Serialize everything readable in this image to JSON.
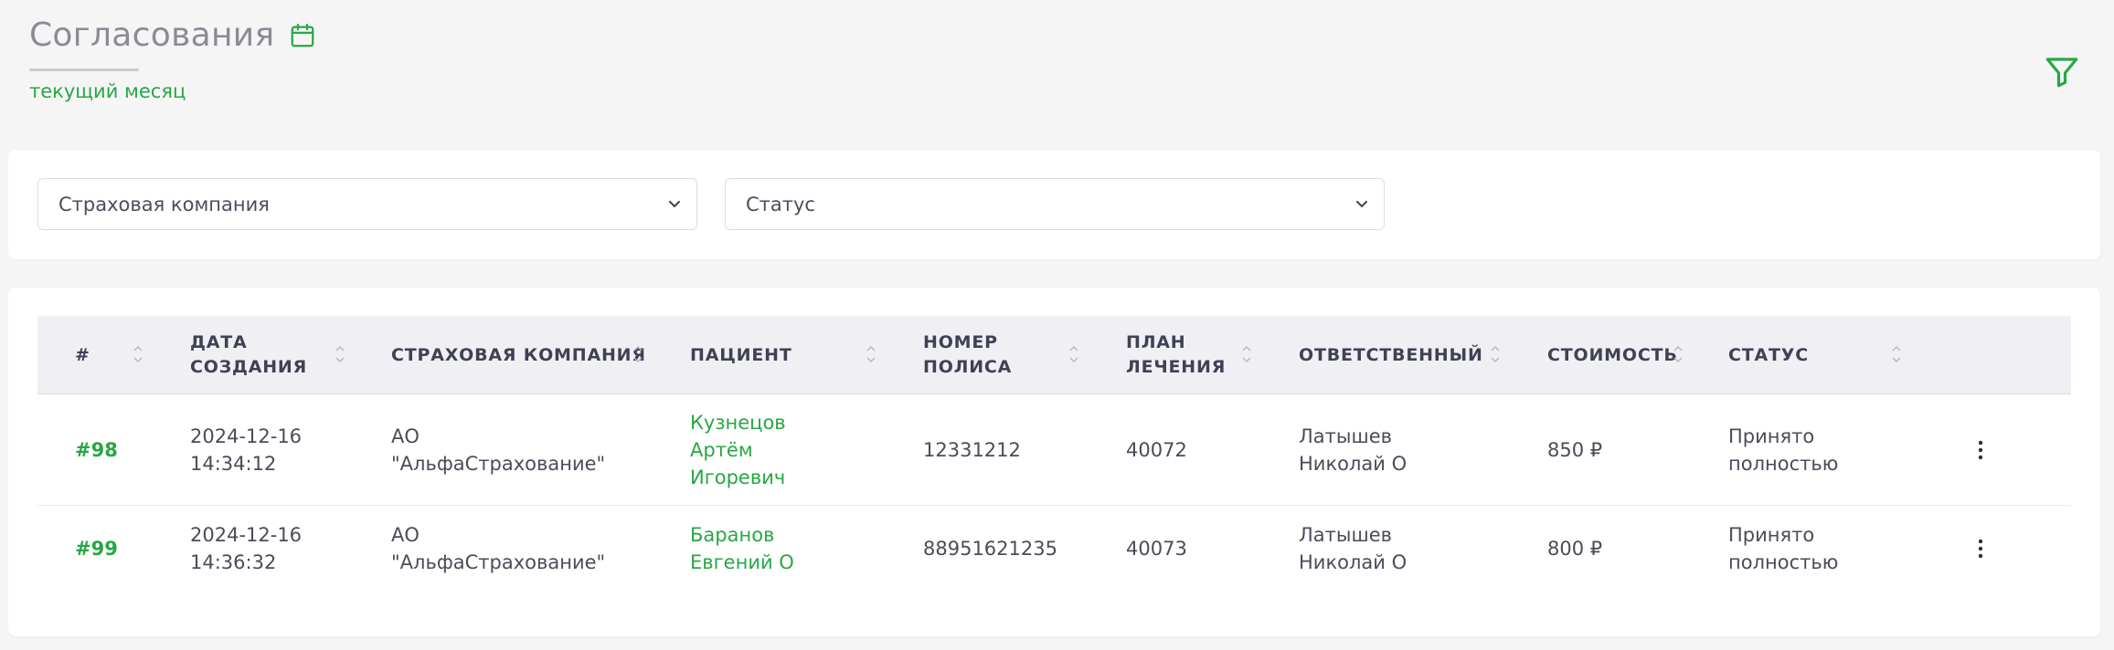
{
  "header": {
    "title": "Согласования",
    "subtitle": "текущий месяц",
    "accent_color": "#28a745",
    "calendar_icon": "calendar-icon",
    "filter_icon": "filter-icon"
  },
  "filters": {
    "insurance_placeholder": "Страховая компания",
    "status_placeholder": "Статус"
  },
  "table": {
    "columns": {
      "num": "#",
      "date_l1": "ДАТА",
      "date_l2": "СОЗДАНИЯ",
      "company": "СТРАХОВАЯ КОМПАНИЯ",
      "patient": "ПАЦИЕНТ",
      "policy_l1": "НОМЕР",
      "policy_l2": "ПОЛИСА",
      "plan_l1": "ПЛАН",
      "plan_l2": "ЛЕЧЕНИЯ",
      "responsible": "ОТВЕТСТВЕННЫЙ",
      "cost": "СТОИМОСТЬ",
      "status": "СТАТУС"
    },
    "rows": [
      {
        "id": "#98",
        "date": "2024-12-16",
        "time": "14:34:12",
        "company_l1": "АО",
        "company_l2": "\"АльфаСтрахование\"",
        "patient_l1": "Кузнецов",
        "patient_l2": "Артём",
        "patient_l3": "Игоревич",
        "policy": "12331212",
        "plan": "40072",
        "responsible_l1": "Латышев",
        "responsible_l2": "Николай О",
        "cost": "850 ₽",
        "status_l1": "Принято",
        "status_l2": "полностью"
      },
      {
        "id": "#99",
        "date": "2024-12-16",
        "time": "14:36:32",
        "company_l1": "АО",
        "company_l2": "\"АльфаСтрахование\"",
        "patient_l1": "Баранов",
        "patient_l2": "Евгений О",
        "policy": "88951621235",
        "plan": "40073",
        "responsible_l1": "Латышев",
        "responsible_l2": "Николай О",
        "cost": "800 ₽",
        "status_l1": "Принято",
        "status_l2": "полностью"
      }
    ]
  }
}
